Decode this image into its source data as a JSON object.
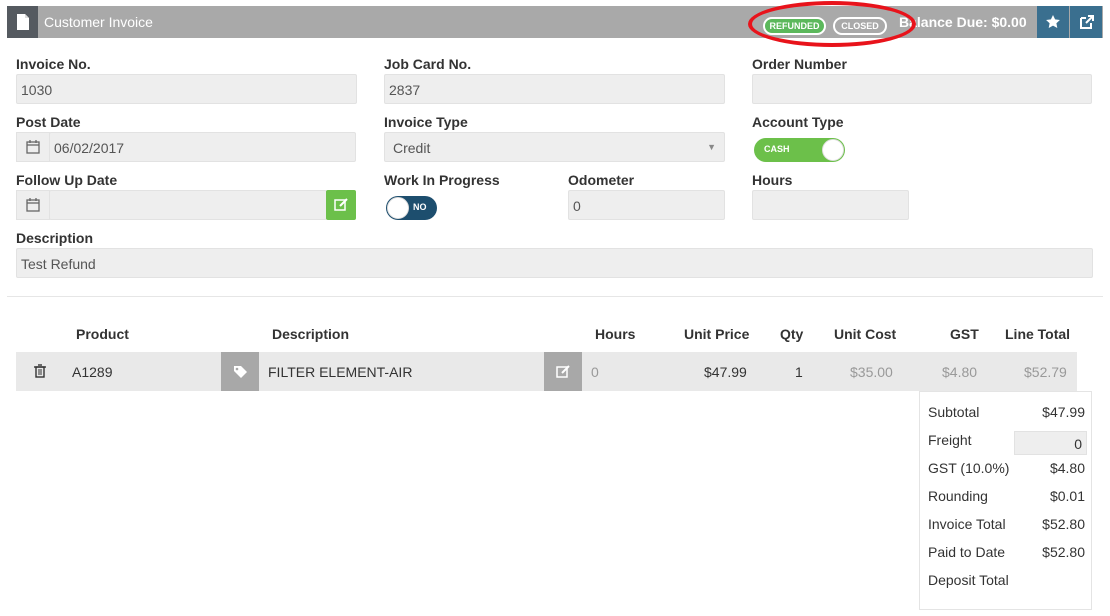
{
  "header": {
    "title": "Customer Invoice",
    "badge_refunded": "REFUNDED",
    "badge_closed": "CLOSED",
    "balance": "Balance Due: $0.00"
  },
  "form": {
    "invoice_no_label": "Invoice No.",
    "invoice_no": "1030",
    "job_card_label": "Job Card No.",
    "job_card": "2837",
    "order_number_label": "Order Number",
    "order_number": "",
    "post_date_label": "Post Date",
    "post_date": "06/02/2017",
    "invoice_type_label": "Invoice Type",
    "invoice_type": "Credit",
    "account_type_label": "Account Type",
    "account_type_toggle": "CASH",
    "follow_up_label": "Follow Up Date",
    "follow_up": "",
    "wip_label": "Work In Progress",
    "wip_toggle": "NO",
    "odometer_label": "Odometer",
    "odometer": "0",
    "hours_label": "Hours",
    "hours": "",
    "description_label": "Description",
    "description": "Test Refund"
  },
  "table": {
    "headers": [
      "Product",
      "Description",
      "Hours",
      "Unit Price",
      "Qty",
      "Unit Cost",
      "GST",
      "Line Total"
    ],
    "rows": [
      {
        "product": "A1289",
        "description": "FILTER ELEMENT-AIR",
        "hours": "0",
        "unit_price": "$47.99",
        "qty": "1",
        "unit_cost": "$35.00",
        "gst": "$4.80",
        "line_total": "$52.79"
      }
    ]
  },
  "totals": {
    "subtotal_label": "Subtotal",
    "subtotal": "$47.99",
    "freight_label": "Freight",
    "freight": "0",
    "gst_label": "GST (10.0%)",
    "gst": "$4.80",
    "rounding_label": "Rounding",
    "rounding": "$0.01",
    "invoice_total_label": "Invoice Total",
    "invoice_total": "$52.80",
    "paid_label": "Paid to Date",
    "paid": "$52.80",
    "deposit_label": "Deposit Total",
    "deposit": ""
  },
  "colors": {
    "header_bg": "#a9a9a9",
    "accent_green": "#6cc04a",
    "accent_blue": "#1d4e6e",
    "annotation_red": "#e8131b"
  },
  "icons": [
    "document-icon",
    "star-icon",
    "external-link-icon",
    "calendar-icon",
    "edit-icon",
    "trash-icon",
    "tag-icon"
  ]
}
